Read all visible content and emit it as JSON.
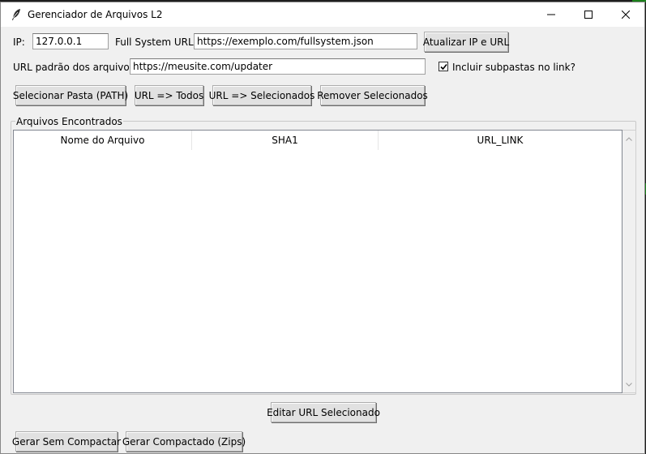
{
  "window": {
    "title": "Gerenciador de Arquivos L2"
  },
  "config": {
    "ip_label": "IP:",
    "ip_value": "127.0.0.1",
    "full_system_label": "Full System URL:",
    "full_system_value": "https://exemplo.com/fullsystem.json",
    "update_button": "Atualizar IP e URL",
    "default_url_label": "URL padrão dos arquivos:",
    "default_url_value": "https://meusite.com/updater",
    "include_subfolders_label": "Incluir subpastas no link?",
    "include_subfolders_checked": true
  },
  "actions": {
    "select_folder": "Selecionar Pasta (PATH)",
    "url_all": "URL => Todos",
    "url_selected": "URL => Selecionados",
    "remove_selected": "Remover Selecionados"
  },
  "files_group": {
    "label": "Arquivos Encontrados",
    "columns": [
      "Nome do Arquivo",
      "SHA1",
      "URL_LINK"
    ],
    "rows": []
  },
  "bottom": {
    "edit_url": "Editar URL Selecionado",
    "generate_uncompressed": "Gerar Sem Compactar",
    "generate_compressed": "Gerar Compactado (Zips)"
  }
}
